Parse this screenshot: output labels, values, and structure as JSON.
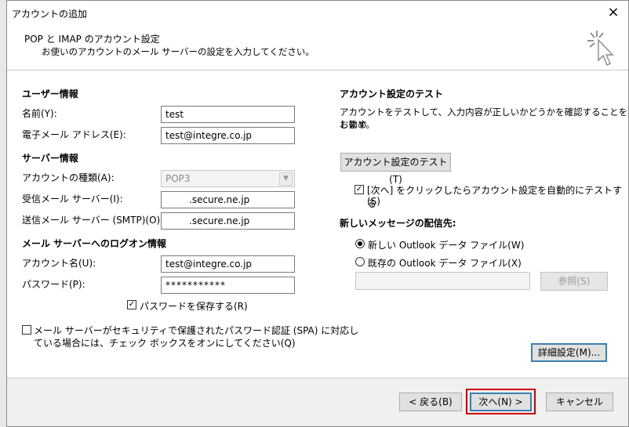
{
  "dialog": {
    "title": "アカウントの追加",
    "heading": "POP と IMAP のアカウント設定",
    "subheading": "お使いのアカウントのメール サーバーの設定を入力してください。",
    "close_icon": "×"
  },
  "user_info": {
    "section": "ユーザー情報",
    "name_label": "名前(Y):",
    "name_value": "test",
    "email_label": "電子メール アドレス(E):",
    "email_value": "test@integre.co.jp"
  },
  "server_info": {
    "section": "サーバー情報",
    "account_type_label": "アカウントの種類(A):",
    "account_type_value": "POP3",
    "incoming_label": "受信メール サーバー(I):",
    "incoming_value": ".secure.ne.jp",
    "outgoing_label": "送信メール サーバー (SMTP)(O):",
    "outgoing_value": ".secure.ne.jp"
  },
  "logon_info": {
    "section": "メール サーバーへのログオン情報",
    "account_label": "アカウント名(U):",
    "account_value": "test@integre.co.jp",
    "password_label": "パスワード(P):",
    "password_value": "***********",
    "remember_label": "パスワードを保存する(R)",
    "remember_checked": true,
    "spa_label_line1": "メール サーバーがセキュリティで保護されたパスワード認証 (SPA) に対応し",
    "spa_label_line2": "ている場合には、チェック ボックスをオンにしてください(Q)",
    "spa_checked": false
  },
  "test_section": {
    "section": "アカウント設定のテスト",
    "description_line1": "アカウントをテストして、入力内容が正しいかどうかを確認することをお勧め",
    "description_line2": "します。",
    "test_button": "アカウント設定のテスト(T)",
    "auto_test_line1": "[次へ] をクリックしたらアカウント設定を自動的にテストする",
    "auto_test_line2": "(S)",
    "auto_test_checked": true
  },
  "delivery": {
    "section": "新しいメッセージの配信先:",
    "new_file_label": "新しい Outlook データ ファイル(W)",
    "existing_file_label": "既存の Outlook データ ファイル(X)",
    "existing_path": "",
    "browse_button": "参照(S)"
  },
  "buttons": {
    "advanced": "詳細設定(M)...",
    "back": "< 戻る(B)",
    "next": "次へ(N) >",
    "cancel": "キャンセル"
  },
  "colors": {
    "highlight_box": "#d00000",
    "focus_border": "#3c7fb1"
  }
}
